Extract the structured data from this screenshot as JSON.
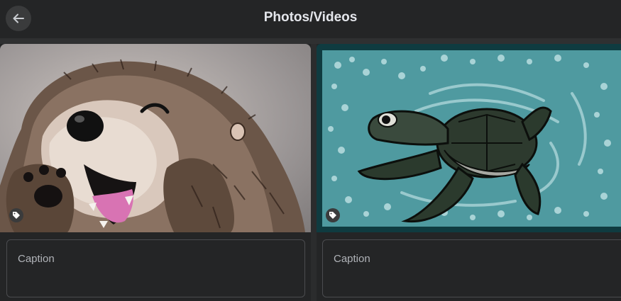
{
  "header": {
    "title": "Photos/Videos",
    "back_icon": "arrow-left-icon"
  },
  "media": [
    {
      "subject": "otter illustration",
      "tag_icon": "tag-icon",
      "caption_placeholder": "Caption"
    },
    {
      "subject": "sea turtle illustration",
      "tag_icon": "tag-icon",
      "caption_placeholder": "Caption"
    }
  ],
  "colors": {
    "header_bg": "#242526",
    "page_bg": "#1c1d1f",
    "text": "#e4e6eb",
    "placeholder": "#b0b3b8"
  }
}
